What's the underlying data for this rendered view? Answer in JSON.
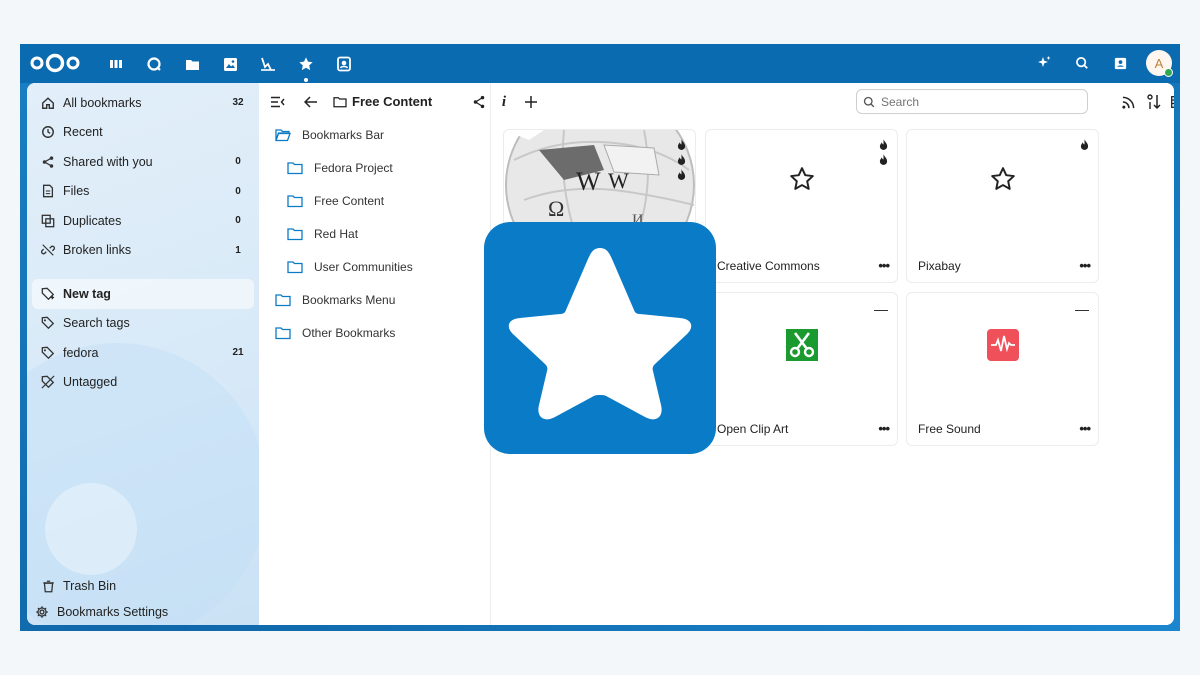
{
  "topbar": {
    "apps": [
      "dashboard-icon",
      "search-app-icon",
      "files-icon",
      "photos-icon",
      "activity-icon",
      "bookmarks-icon",
      "contacts-app-icon"
    ],
    "avatar_letter": "A"
  },
  "sidebar": {
    "items": [
      {
        "label": "All bookmarks",
        "count": "32",
        "icon": "home-icon"
      },
      {
        "label": "Recent",
        "count": "",
        "icon": "history-icon"
      },
      {
        "label": "Shared with you",
        "count": "0",
        "icon": "share-icon"
      },
      {
        "label": "Files",
        "count": "0",
        "icon": "file-icon"
      },
      {
        "label": "Duplicates",
        "count": "0",
        "icon": "duplicate-icon"
      },
      {
        "label": "Broken links",
        "count": "1",
        "icon": "broken-link-icon"
      }
    ],
    "tags": [
      {
        "label": "New tag",
        "count": "",
        "icon": "tag-plus-icon"
      },
      {
        "label": "Search tags",
        "count": "",
        "icon": "tag-search-icon"
      },
      {
        "label": "fedora",
        "count": "21",
        "icon": "tag-icon"
      },
      {
        "label": "Untagged",
        "count": "",
        "icon": "tag-off-icon"
      }
    ],
    "bottom": [
      {
        "label": "Trash Bin",
        "icon": "trash-icon"
      },
      {
        "label": "Bookmarks Settings",
        "icon": "gear-icon"
      }
    ]
  },
  "toolbar": {
    "folder_title": "Free Content",
    "search_placeholder": "Search"
  },
  "folders": [
    {
      "label": "Bookmarks Bar",
      "open": true,
      "indent": 0
    },
    {
      "label": "Fedora Project",
      "open": false,
      "indent": 1
    },
    {
      "label": "Free Content",
      "open": false,
      "indent": 1
    },
    {
      "label": "Red Hat",
      "open": false,
      "indent": 1
    },
    {
      "label": "User Communities",
      "open": false,
      "indent": 1
    },
    {
      "label": "Bookmarks Menu",
      "open": false,
      "indent": 0
    },
    {
      "label": "Other Bookmarks",
      "open": false,
      "indent": 0
    }
  ],
  "cards": [
    {
      "title": "",
      "image": "wikipedia-globe"
    },
    {
      "title": "Creative Commons",
      "image": "star-outline-icon"
    },
    {
      "title": "Pixabay",
      "image": "star-outline-icon"
    },
    {
      "title": "Open Clip Art",
      "image": "scissors-icon"
    },
    {
      "title": "Free Sound",
      "image": "sound-wave-icon"
    }
  ],
  "colors": {
    "brand": "#0b6bb0",
    "folder": "#0a7bc7",
    "overlay": "#0a7bc7",
    "openclipart": "#1a9a2f",
    "freesound": "#f0505a"
  }
}
